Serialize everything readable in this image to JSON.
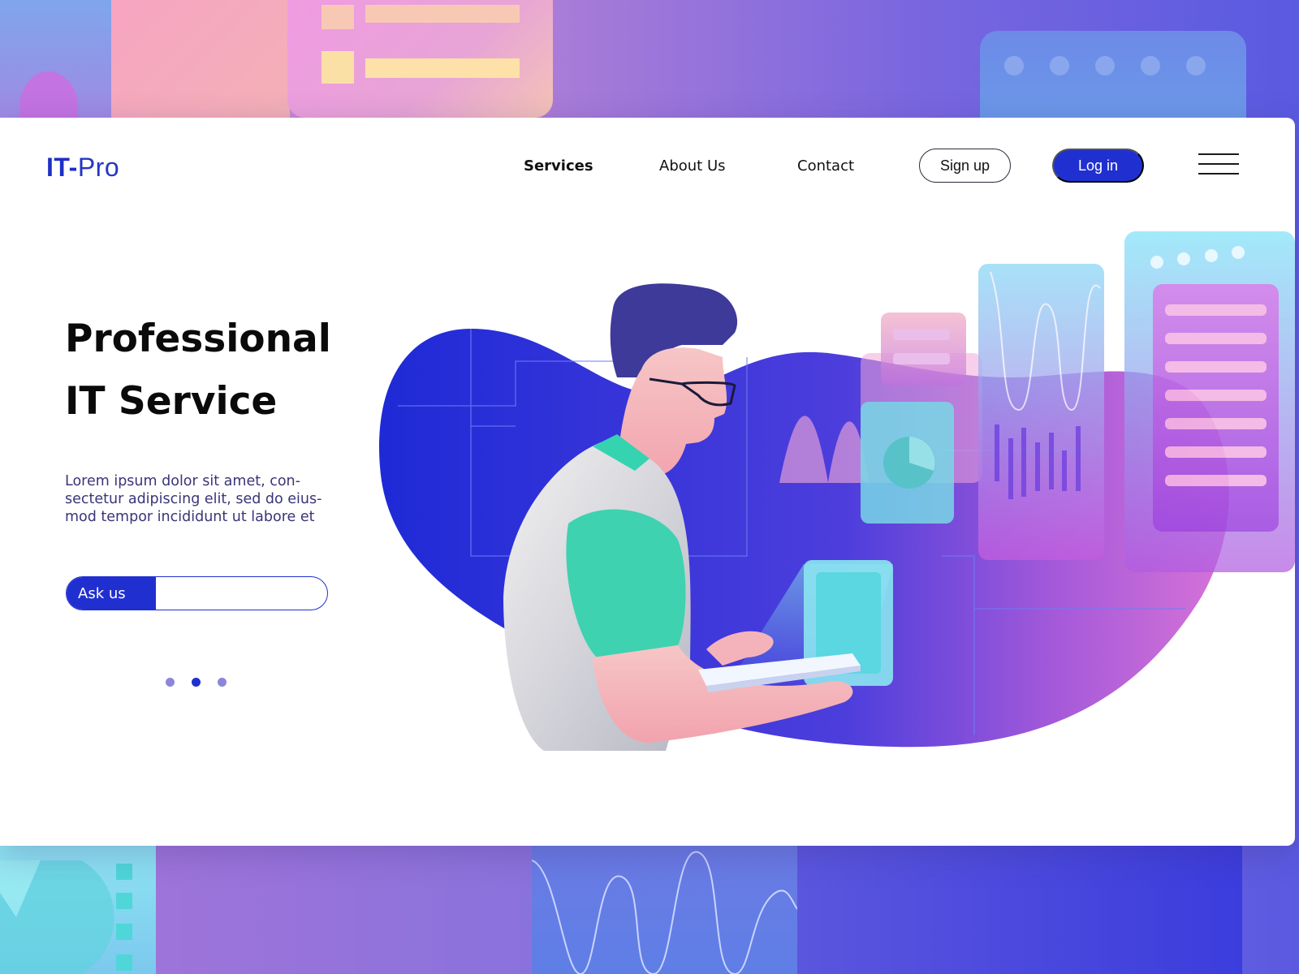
{
  "header": {
    "logo_bold": "IT-",
    "logo_light": "Pro",
    "nav": [
      {
        "label": "Services",
        "active": true
      },
      {
        "label": "About Us",
        "active": false
      },
      {
        "label": "Contact",
        "active": false
      }
    ],
    "signup_label": "Sign up",
    "login_label": "Log in"
  },
  "hero": {
    "title_line1": "Professional",
    "title_line2": "IT Service",
    "body_lines": [
      "Lorem ipsum dolor sit amet, con-",
      "sectetur adipiscing elit, sed do eius-",
      "mod tempor incididunt ut labore et"
    ],
    "ask_label": "Ask us",
    "ask_value": ""
  },
  "carousel": {
    "count": 3,
    "active_index": 1
  },
  "colors": {
    "brand": "#2030d0",
    "dot_inactive": "#8b86d8",
    "dot_active": "#2030d0"
  }
}
